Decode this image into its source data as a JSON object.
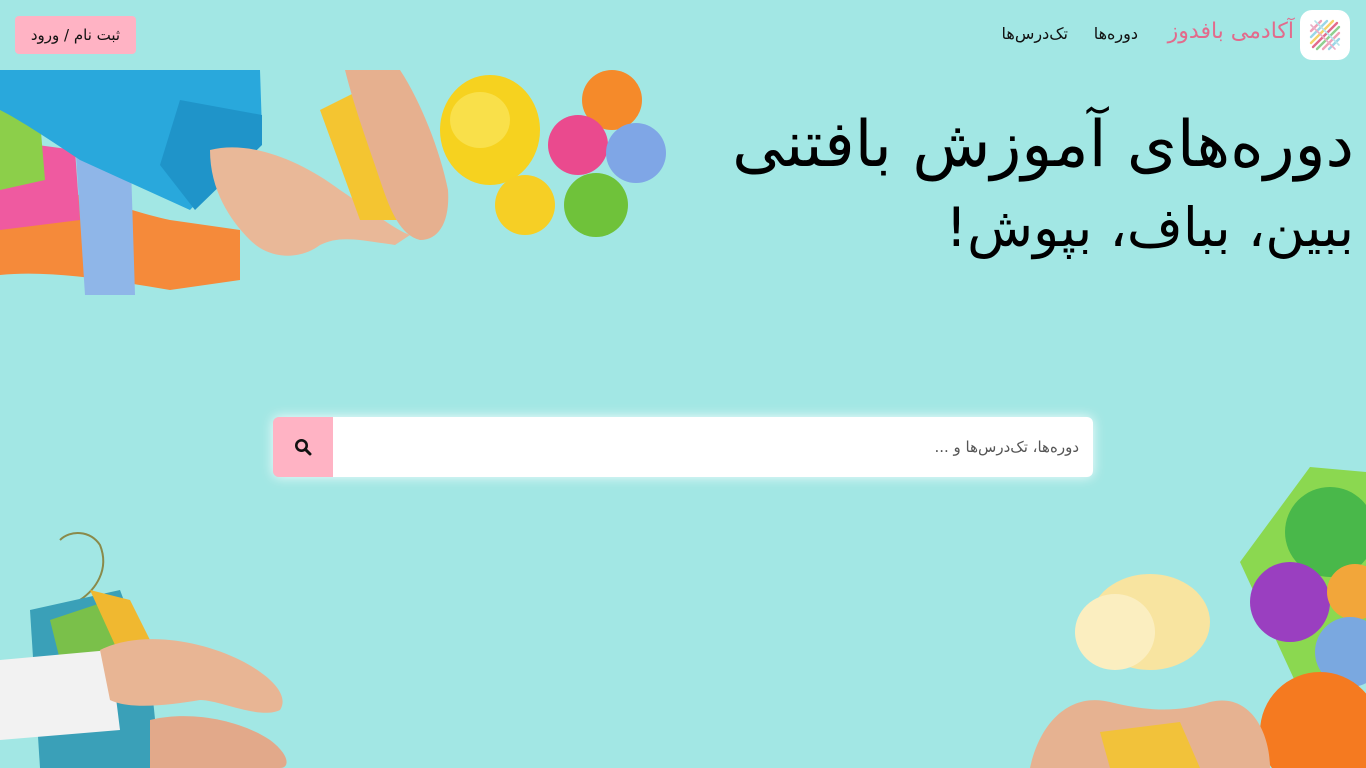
{
  "header": {
    "brand": "آکادمی بافدوز",
    "nav": {
      "courses": "دوره‌ها",
      "lessons": "تک‌درس‌ها"
    },
    "auth_label": "ثبت نام / ورود"
  },
  "hero": {
    "title": "دوره‌های آموزش بافتنی",
    "subtitle": "ببین، بباف، بپوش!"
  },
  "search": {
    "placeholder": "دوره‌ها، تک‌درس‌ها و ..."
  },
  "icons": {
    "logo": "yarn-logo-icon",
    "search": "search-icon"
  },
  "colors": {
    "background": "#a2e7e4",
    "brand": "#e26b8c",
    "accent_pink": "#ffb3c4"
  }
}
